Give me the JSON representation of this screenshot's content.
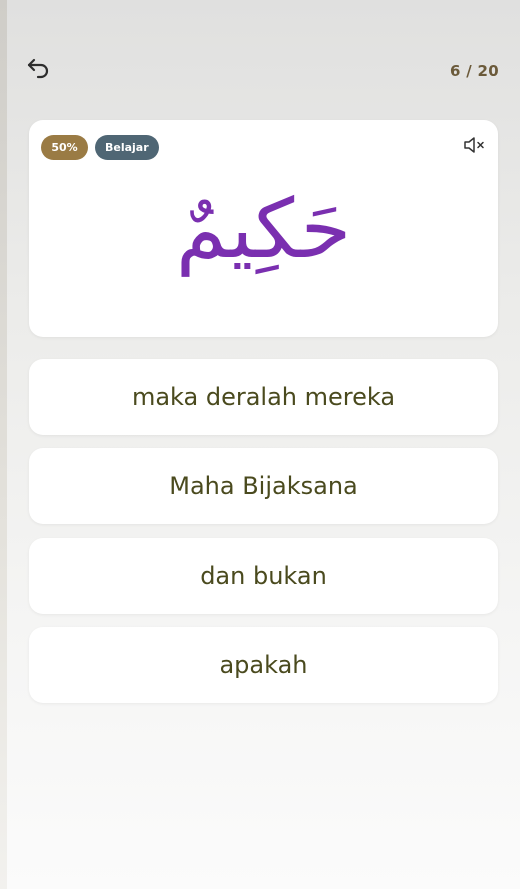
{
  "header": {
    "back_icon": "undo-arrow-icon",
    "progress": "6 / 20"
  },
  "word_card": {
    "percent_badge": "50%",
    "mode_badge": "Belajar",
    "mute_icon": "speaker-muted-icon",
    "arabic_word": "حَكِيمٌ"
  },
  "options": [
    {
      "label": "maka deralah mereka"
    },
    {
      "label": "Maha Bijaksana"
    },
    {
      "label": "dan bukan"
    },
    {
      "label": "apakah"
    }
  ],
  "colors": {
    "accent_gold": "#9a7b44",
    "badge_slate": "#4f6674",
    "arabic_purple": "#7a2fb0",
    "option_text": "#4a4a1e"
  }
}
